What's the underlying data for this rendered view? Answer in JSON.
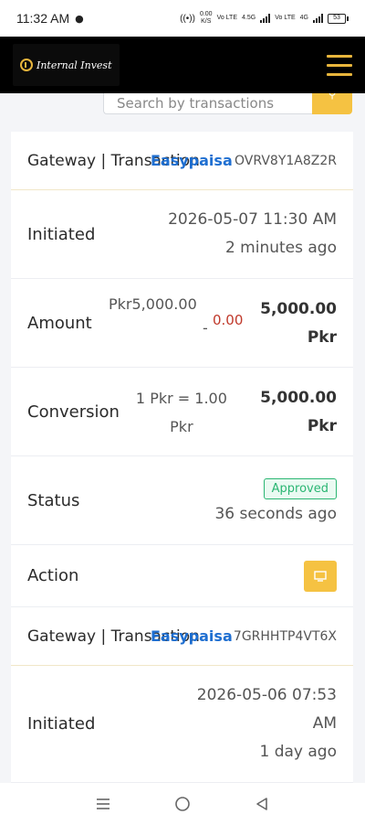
{
  "status_bar": {
    "time": "11:32 AM",
    "speed": "0.00",
    "speed_unit": "K/S",
    "net1": "Vo LTE",
    "net2": "4.5G",
    "net3": "Vo LTE",
    "net4": "4G",
    "battery": "53"
  },
  "app": {
    "brand": "Internal Invest",
    "icons": {
      "menu": "hamburger-menu-icon",
      "search": "search-icon",
      "action": "desktop-icon"
    },
    "accent_color": "#f5c242"
  },
  "search": {
    "placeholder": "Search by transactions"
  },
  "transactions": [
    {
      "header_label": "Gateway | Transaction",
      "gateway": "Easypaisa",
      "trx": "OVRV8Y1A8Z2R",
      "initiated_label": "Initiated",
      "initiated_datetime": "2026-05-07 11:30 AM",
      "initiated_ago": "2 minutes ago",
      "amount_label": "Amount",
      "amount": "Pkr5,000.00",
      "amount_dash": "-",
      "charge": "0.00",
      "amount_total": "5,000.00",
      "amount_total_currency": "Pkr",
      "conversion_label": "Conversion",
      "conversion_rate": "1 Pkr = 1.00",
      "conversion_rate_currency": "Pkr",
      "conversion_total": "5,000.00",
      "conversion_total_currency": "Pkr",
      "status_label": "Status",
      "status": "Approved",
      "status_ago": "36 seconds ago",
      "action_label": "Action"
    },
    {
      "header_label": "Gateway | Transaction",
      "gateway": "Easypaisa",
      "trx": "7GRHHTP4VT6X",
      "initiated_label": "Initiated",
      "initiated_date": "2026-05-06 07:53",
      "initiated_ampm": "AM",
      "initiated_ago": "1 day ago"
    }
  ]
}
